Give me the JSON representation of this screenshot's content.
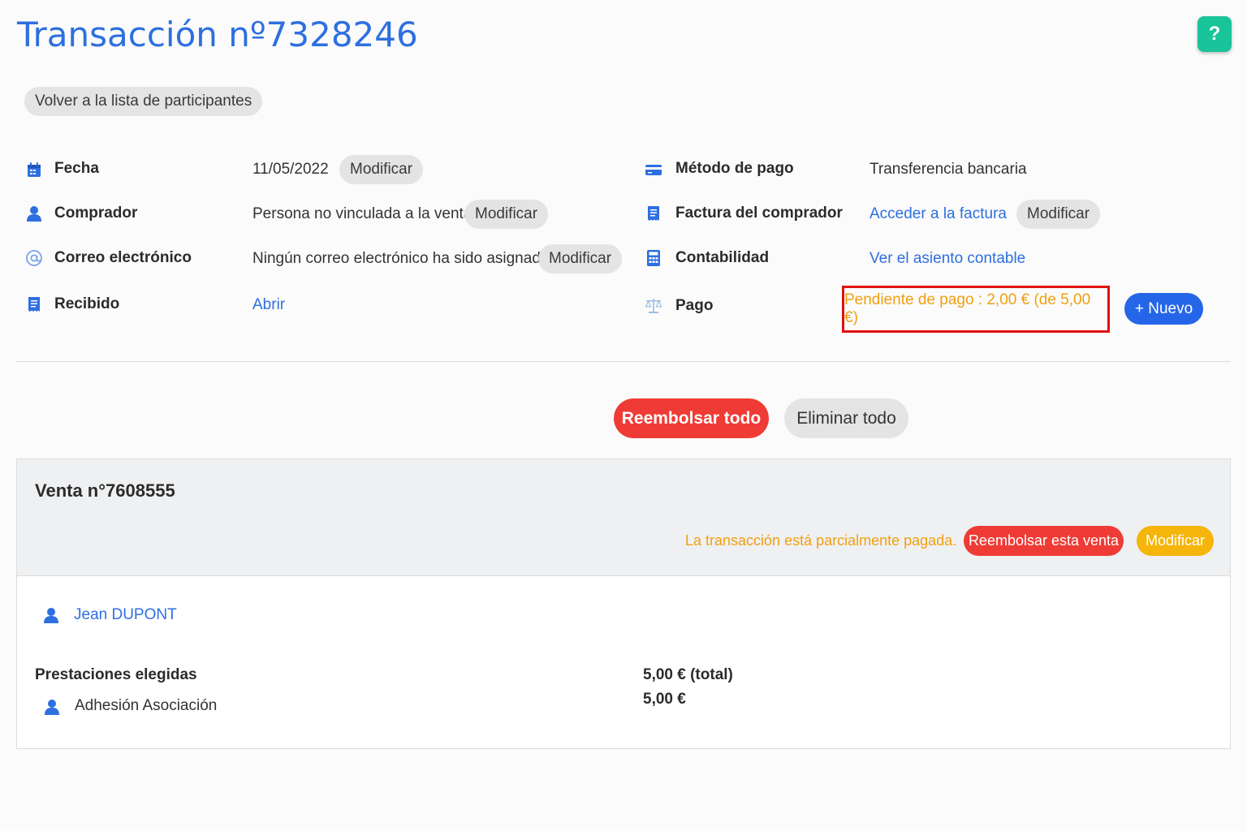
{
  "header": {
    "title": "Transacción nº7328246",
    "help_label": "?"
  },
  "back_button": "Volver a la lista de participantes",
  "details_left": [
    {
      "label": "Fecha",
      "value": "11/05/2022",
      "action": "Modificar",
      "icon": "calendar-icon"
    },
    {
      "label": "Comprador",
      "value": "Persona no vinculada a la venta",
      "action": "Modificar",
      "icon": "user-icon"
    },
    {
      "label": "Correo electrónico",
      "value": "Ningún correo electrónico ha sido asignado.",
      "action": "Modificar",
      "icon": "at-icon"
    },
    {
      "label": "Recibido",
      "link": "Abrir",
      "icon": "receipt-icon"
    }
  ],
  "details_right": [
    {
      "label": "Método de pago",
      "value": "Transferencia bancaria",
      "icon": "credit-card-icon"
    },
    {
      "label": "Factura del comprador",
      "link": "Acceder a la factura",
      "action": "Modificar",
      "icon": "invoice-icon"
    },
    {
      "label": "Contabilidad",
      "link": "Ver el asiento contable",
      "icon": "calculator-icon"
    },
    {
      "label": "Pago",
      "status": "Pendiente de pago : 2,00 € (de 5,00 €)",
      "action": "+ Nuevo",
      "icon": "scale-icon"
    }
  ],
  "actions": {
    "refund_all": "Reembolsar todo",
    "delete_all": "Eliminar todo"
  },
  "sale": {
    "title": "Venta n°7608555",
    "status": "La transacción está parcialmente pagada.",
    "refund_label": "Reembolsar esta venta",
    "modify_label": "Modificar",
    "participant": "Jean DUPONT",
    "services_title": "Prestaciones elegidas",
    "total": "5,00 € (total)",
    "items": [
      {
        "name": "Adhesión Asociación",
        "price": "5,00 €"
      }
    ]
  },
  "colors": {
    "primary": "#2e6fe0",
    "danger": "#ef3b35",
    "warning": "#f5b50a",
    "pending": "#f0a010",
    "help": "#19c49a"
  }
}
